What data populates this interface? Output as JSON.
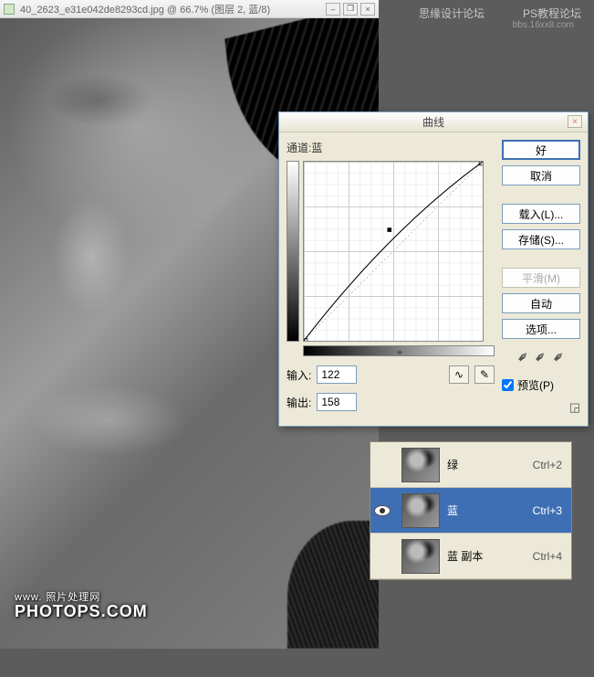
{
  "doc": {
    "title": "40_2623_e31e042de8293cd.jpg @ 66.7% (图层 2, 蓝/8)",
    "watermark_small": "www.   照片处理网",
    "watermark": "PHOTOPS.COM"
  },
  "header": {
    "text1": "思缘设计论坛",
    "text2": "PS教程论坛",
    "sub": "bbs.16xx8.com"
  },
  "curves": {
    "title": "曲线",
    "channel_label": "通道:",
    "channel_value": "蓝",
    "input_label": "输入:",
    "input_value": "122",
    "output_label": "输出:",
    "output_value": "158",
    "buttons": {
      "ok": "好",
      "cancel": "取消",
      "load": "载入(L)...",
      "save": "存储(S)...",
      "smooth": "平滑(M)",
      "auto": "自动",
      "options": "选项..."
    },
    "preview_label": "预览(P)"
  },
  "channels": {
    "rows": [
      {
        "name": "绿",
        "shortcut": "Ctrl+2",
        "eye": false,
        "selected": false
      },
      {
        "name": "蓝",
        "shortcut": "Ctrl+3",
        "eye": true,
        "selected": true
      },
      {
        "name": "蓝 副本",
        "shortcut": "Ctrl+4",
        "eye": false,
        "selected": false
      }
    ]
  },
  "chart_data": {
    "type": "line",
    "title": "曲线",
    "xlabel": "输入",
    "ylabel": "输出",
    "xlim": [
      0,
      255
    ],
    "ylim": [
      0,
      255
    ],
    "series": [
      {
        "name": "蓝",
        "x": [
          0,
          122,
          255
        ],
        "y": [
          0,
          158,
          255
        ]
      }
    ],
    "control_point": {
      "input": 122,
      "output": 158
    }
  }
}
